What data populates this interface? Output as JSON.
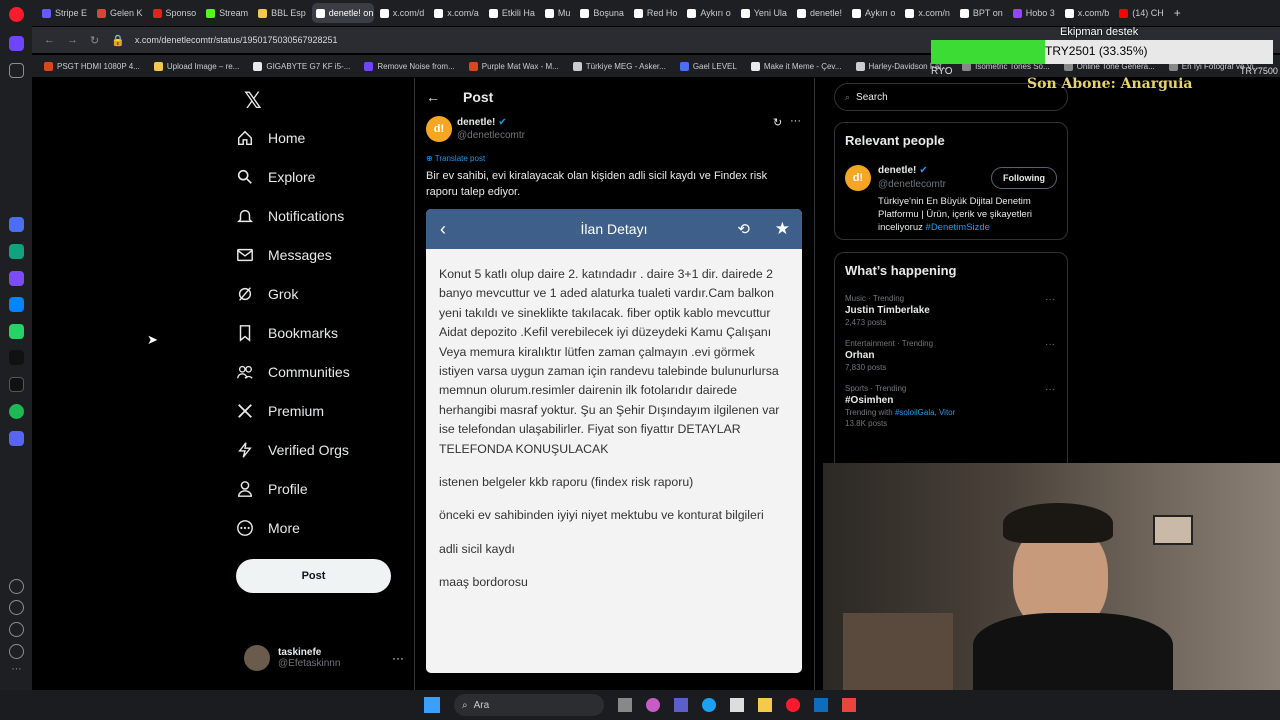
{
  "browser": {
    "tabs": [
      {
        "label": "Stripe E",
        "color": "#635bff"
      },
      {
        "label": "Gelen K",
        "color": "#d44638"
      },
      {
        "label": "Sponso",
        "color": "#e2231a"
      },
      {
        "label": "Stream",
        "color": "#53fc18",
        "active": false
      },
      {
        "label": "BBL Esp",
        "color": "#f2c94c"
      },
      {
        "label": "denetle! on X",
        "color": "#ffffff",
        "active": true
      },
      {
        "label": "x.com/d",
        "color": "#ffffff"
      },
      {
        "label": "x.com/a",
        "color": "#ffffff"
      },
      {
        "label": "Etkili Ha",
        "color": "#ffffff"
      },
      {
        "label": "Mu",
        "color": "#ffffff"
      },
      {
        "label": "Boşuna",
        "color": "#ffffff"
      },
      {
        "label": "Red Ho",
        "color": "#ffffff"
      },
      {
        "label": "Aykırı o",
        "color": "#ffffff"
      },
      {
        "label": "Yeni Ula",
        "color": "#ffffff"
      },
      {
        "label": "denetle!",
        "color": "#ffffff"
      },
      {
        "label": "Aykırı o",
        "color": "#ffffff"
      },
      {
        "label": "x.com/n",
        "color": "#ffffff"
      },
      {
        "label": "BPT on",
        "color": "#ffffff"
      },
      {
        "label": "Hobo 3",
        "color": "#9146ff"
      },
      {
        "label": "x.com/b",
        "color": "#ffffff"
      },
      {
        "label": "(14) CH",
        "color": "#ff0000"
      }
    ],
    "url": "x.com/denetlecomtr/status/1950175030567928251",
    "bookmarks": [
      "PSGT HDMI 1080P 4...",
      "Upload Image – re...",
      "GIGABYTE G7 KF i5-...",
      "Remove Noise from...",
      "Purple Mat Wax - M...",
      "Türkiye MEG - Asker...",
      "Gael LEVEL",
      "Make it Meme - Çev...",
      "Harley-Davidson Fat...",
      "Isometric Tones So...",
      "Online Tone Genera...",
      "En İyi Fotoğraf ve Vi..."
    ]
  },
  "stream_overlay": {
    "title": "Ekipman destek",
    "progress_text": "TRY2501 (33.35%)",
    "progress_fraction": 0.3335,
    "left_label": "RYO",
    "right_label": "TRY7500",
    "last_sub": "Son Abone: Anarguia"
  },
  "nav": {
    "items": [
      {
        "label": "Home",
        "icon": "home-icon"
      },
      {
        "label": "Explore",
        "icon": "search-icon"
      },
      {
        "label": "Notifications",
        "icon": "bell-icon"
      },
      {
        "label": "Messages",
        "icon": "envelope-icon"
      },
      {
        "label": "Grok",
        "icon": "grok-icon"
      },
      {
        "label": "Bookmarks",
        "icon": "bookmark-icon"
      },
      {
        "label": "Communities",
        "icon": "people-icon"
      },
      {
        "label": "Premium",
        "icon": "x-icon"
      },
      {
        "label": "Verified Orgs",
        "icon": "lightning-icon"
      },
      {
        "label": "Profile",
        "icon": "person-icon"
      },
      {
        "label": "More",
        "icon": "more-icon"
      }
    ],
    "post_button": "Post",
    "account": {
      "name": "taskinefe",
      "handle": "@Efetaskinnn"
    }
  },
  "post": {
    "header": "Post",
    "author": {
      "name": "denetle!",
      "handle": "@denetlecomtr",
      "avatar_text": "d!"
    },
    "translate": "Translate post",
    "text": "Bir ev sahibi, evi kiralayacak olan kişiden adli sicil kaydı ve Findex risk raporu talep ediyor.",
    "image": {
      "header_title": "İlan Detayı",
      "paragraphs": [
        "Konut 5 katlı olup daire 2. katındadır . daire 3+1 dir. dairede 2 banyo mevcuttur ve 1 aded alaturka tualeti vardır.Cam balkon yeni takıldı ve sineklikte takılacak. fiber optik kablo mevcuttur Aidat depozito .Kefil verebilecek iyi düzeydeki Kamu Çalışanı Veya memura kiralıktır lütfen zaman çalmayın .evi görmek istiyen varsa uygun zaman için randevu talebinde bulunurlursa memnun olurum.resimler dairenin ilk fotolarıdır dairede herhangibi masraf yoktur. Şu an Şehir Dışındayım ilgilenen var ise telefondan ulaşabilirler. Fiyat son fiyattır DETAYLAR TELEFONDA KONUŞULACAK",
        "istenen belgeler kkb raporu (findex risk raporu)",
        "önceki ev sahibinden iyiyi niyet mektubu ve konturat bilgileri",
        "adli sicil kaydı",
        "maaş bordorosu"
      ]
    }
  },
  "sidebar": {
    "search_placeholder": "Search",
    "relevant_title": "Relevant people",
    "person": {
      "name": "denetle!",
      "handle": "@denetlecomtr",
      "follow_label": "Following",
      "bio": "Türkiye'nin En Büyük Dijital Denetim Platformu | Ürün, içerik ve şikayetleri inceliyoruz",
      "bio_tag": "#DenetimSizde"
    },
    "happening_title": "What’s happening",
    "trends": [
      {
        "category": "Music · Trending",
        "name": "Justin Timberlake",
        "count": "2,473 posts",
        "with": ""
      },
      {
        "category": "Entertainment · Trending",
        "name": "Orhan",
        "count": "7,830 posts",
        "with": ""
      },
      {
        "category": "Sports · Trending",
        "name": "#Osimhen",
        "count": "13.8K posts",
        "with_prefix": "Trending with",
        "with": "#soloilGala, Vitor"
      }
    ]
  },
  "taskbar": {
    "search_placeholder": "Ara"
  },
  "colors": {
    "accent": "#1d9bf0",
    "listing_header": "#3f5f8b",
    "brand_orange": "#f5a623"
  }
}
